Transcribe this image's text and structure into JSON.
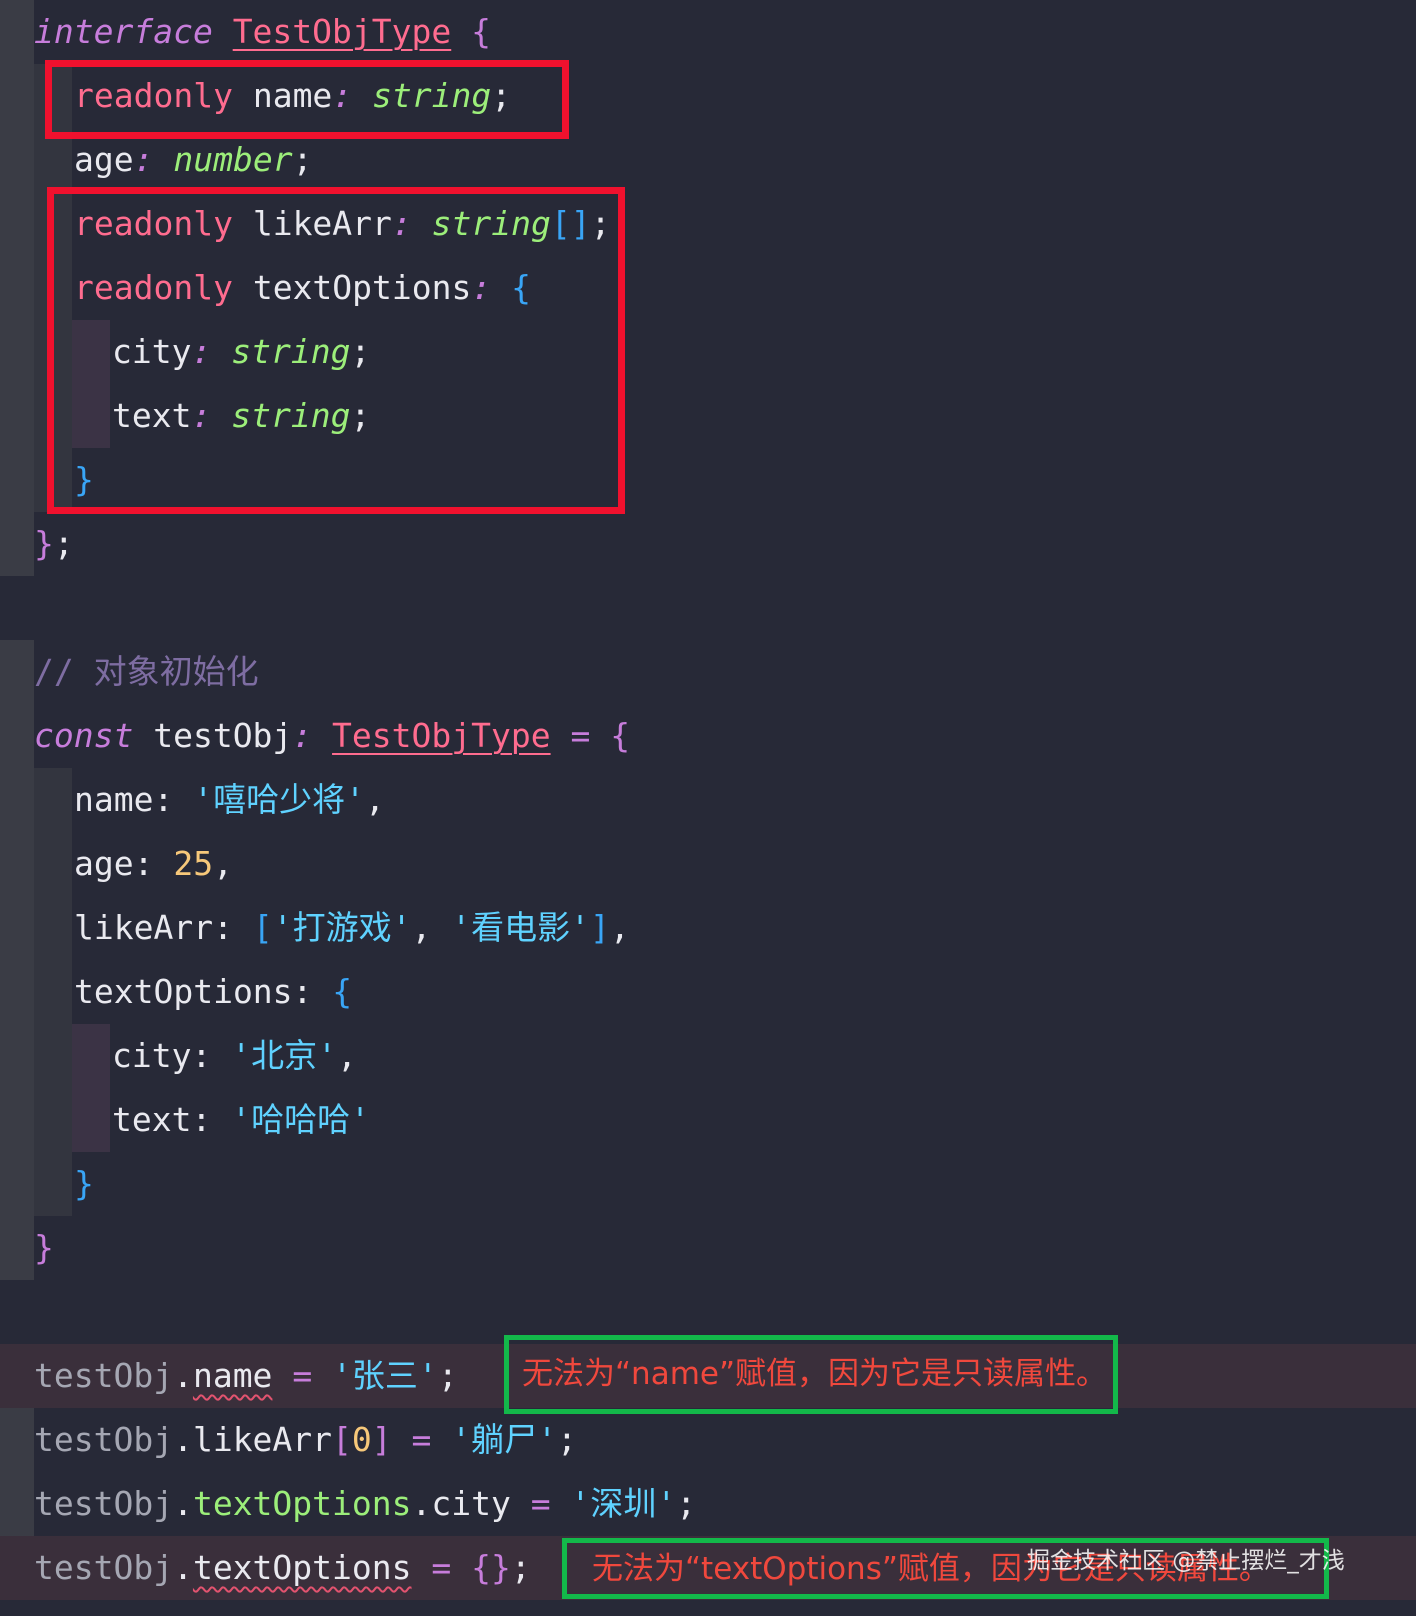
{
  "iface": {
    "kw": "interface",
    "name": "TestObjType",
    "open": "{",
    "close": "}",
    "semi": ";",
    "ro": "readonly",
    "p_name": "name",
    "p_age": "age",
    "p_like": "likeArr",
    "p_text": "textOptions",
    "p_city": "city",
    "p_textf": "text",
    "t_string": "string",
    "t_number": "number",
    "t_arr": "[]"
  },
  "comment": "// 对象初始化",
  "obj": {
    "kw": "const",
    "var": "testObj",
    "type": "TestObjType",
    "eq": "=",
    "name_val": "'嘻哈少将'",
    "age_val": "25",
    "like_val1": "'打游戏'",
    "like_val2": "'看电影'",
    "city_val": "'北京'",
    "text_val": "'哈哈哈'"
  },
  "assign": {
    "obj": "testObj",
    "p_name": "name",
    "v_name": "'张三'",
    "p_like": "likeArr",
    "idx": "0",
    "v_like": "'躺尸'",
    "p_text": "textOptions",
    "p_city": "city",
    "v_city": "'深圳'",
    "v_empty": "{}"
  },
  "errors": {
    "e1": "无法为“name”赋值，因为它是只读属性。",
    "e2": "无法为“textOptions”赋值，因为它是只读属性。"
  },
  "watermark": "掘金技术社区 @禁止摆烂_才浅",
  "colors": {
    "background": "#272937",
    "red_box": "#f0112e",
    "green_box": "#13b84a",
    "error_text": "#f0483d"
  }
}
